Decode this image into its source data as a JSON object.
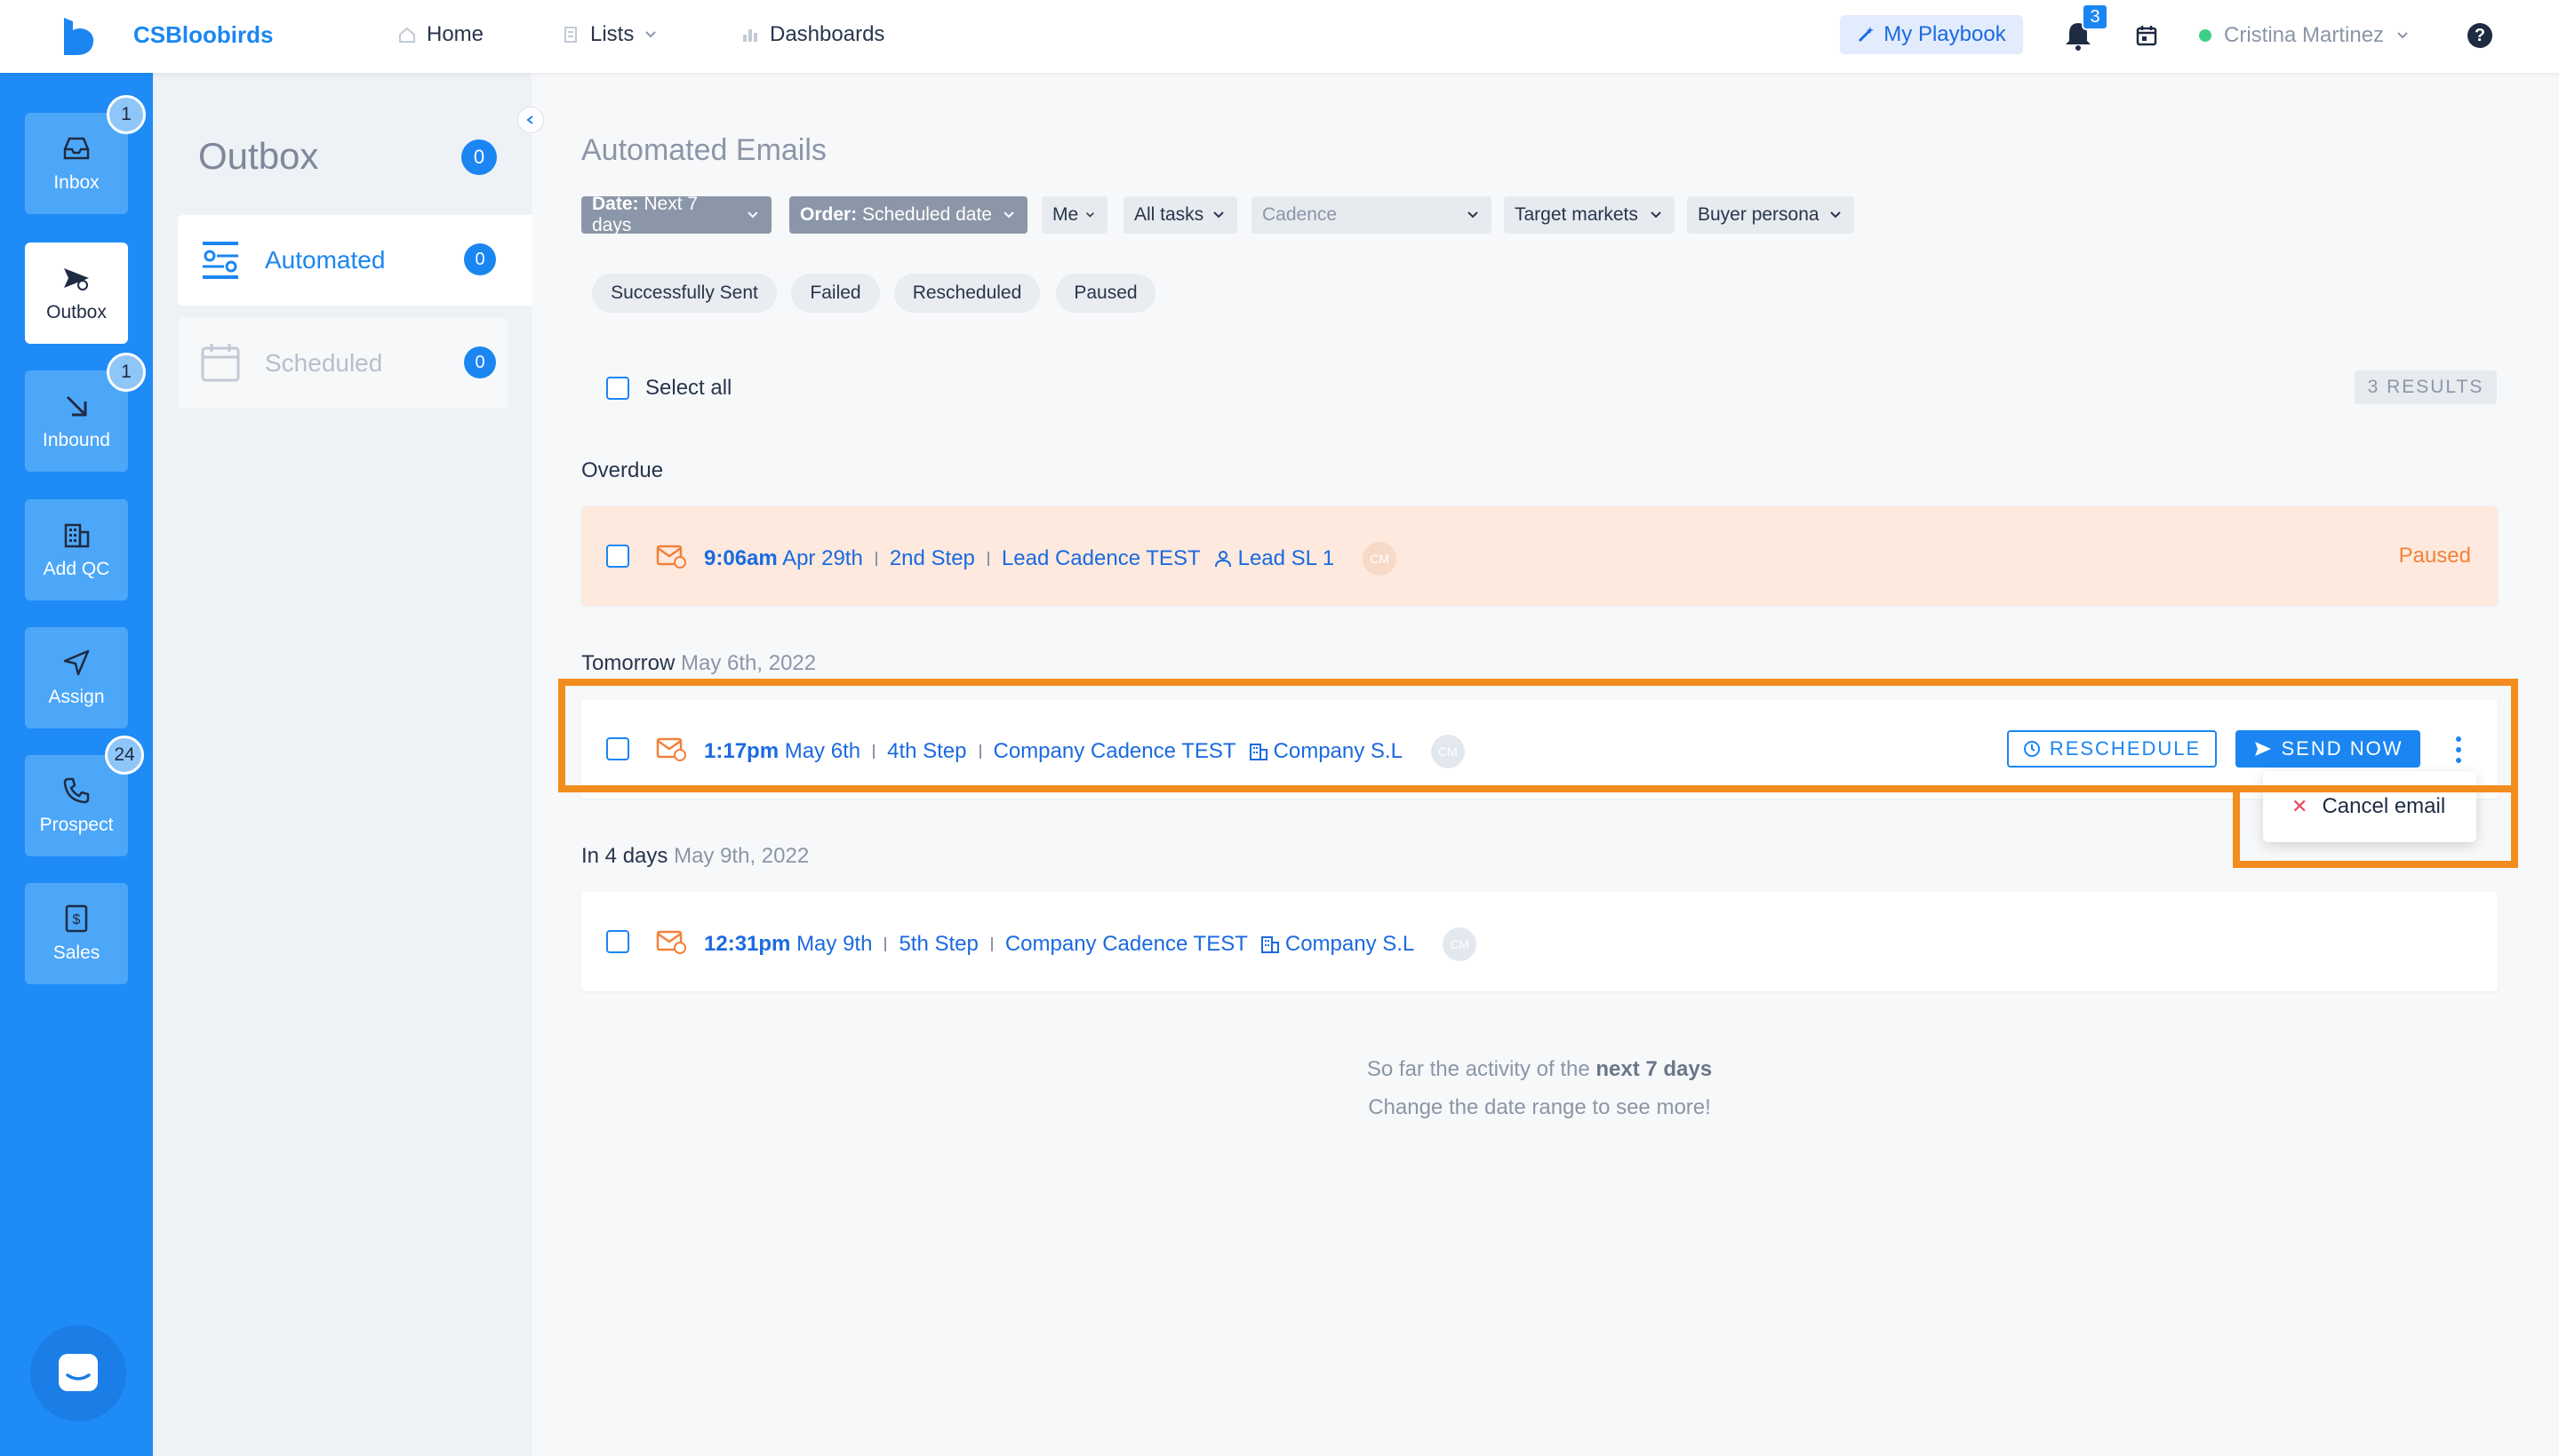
{
  "app": {
    "brand": "CSBloobirds"
  },
  "nav": {
    "home": "Home",
    "lists": "Lists",
    "dashboards": "Dashboards"
  },
  "topbar": {
    "playbook": "My Playbook",
    "notifications_count": "3",
    "user_name": "Cristina Martinez",
    "help": "?"
  },
  "sidebar": {
    "items": [
      {
        "label": "Inbox",
        "badge": "1",
        "icon": "inbox-icon"
      },
      {
        "label": "Outbox",
        "icon": "send-icon"
      },
      {
        "label": "Inbound",
        "badge": "1",
        "icon": "arrow-down-right-icon"
      },
      {
        "label": "Add QC",
        "icon": "building-icon"
      },
      {
        "label": "Assign",
        "icon": "navigation-icon"
      },
      {
        "label": "Prospect",
        "badge": "24",
        "icon": "phone-icon"
      },
      {
        "label": "Sales",
        "icon": "dollar-icon"
      }
    ]
  },
  "panel": {
    "title": "Outbox",
    "count": "0",
    "tabs": [
      {
        "label": "Automated",
        "count": "0"
      },
      {
        "label": "Scheduled",
        "count": "0"
      }
    ]
  },
  "main": {
    "title": "Automated Emails",
    "filters": {
      "date_key": "Date:",
      "date_val": "Next 7 days",
      "order_key": "Order:",
      "order_val": "Scheduled date",
      "me": "Me",
      "tasks": "All tasks",
      "cadence": "Cadence",
      "markets": "Target markets",
      "persona": "Buyer persona"
    },
    "chips": [
      "Successfully Sent",
      "Failed",
      "Rescheduled",
      "Paused"
    ],
    "select_all": "Select all",
    "results": "3 RESULTS",
    "groups": [
      {
        "title": "Overdue",
        "subtitle": "",
        "row": {
          "time": "9:06am",
          "date": "Apr 29th",
          "step": "2nd Step",
          "cadence": "Lead Cadence TEST",
          "target": "Lead SL 1",
          "avatar": "CM",
          "status": "Paused"
        }
      },
      {
        "title": "Tomorrow",
        "subtitle": "May 6th, 2022",
        "row": {
          "time": "1:17pm",
          "date": "May 6th",
          "step": "4th Step",
          "cadence": "Company Cadence TEST",
          "target": "Company S.L",
          "avatar": "CM"
        }
      },
      {
        "title": "In 4 days",
        "subtitle": "May 9th, 2022",
        "row": {
          "time": "12:31pm",
          "date": "May 9th",
          "step": "5th Step",
          "cadence": "Company Cadence TEST",
          "target": "Company S.L",
          "avatar": "CM"
        }
      }
    ],
    "actions": {
      "reschedule": "RESCHEDULE",
      "send_now": "SEND NOW",
      "cancel": "Cancel email"
    },
    "footer": {
      "line1_pre": "So far the activity of the",
      "line1_bold": "next 7 days",
      "line2": "Change the date range to see more!"
    }
  },
  "colors": {
    "primary": "#1b86f2",
    "sidebar": "#1e8bf7",
    "highlight": "#f28c1f",
    "overdue_bg": "#fde9dd",
    "paused": "#f2813a"
  }
}
